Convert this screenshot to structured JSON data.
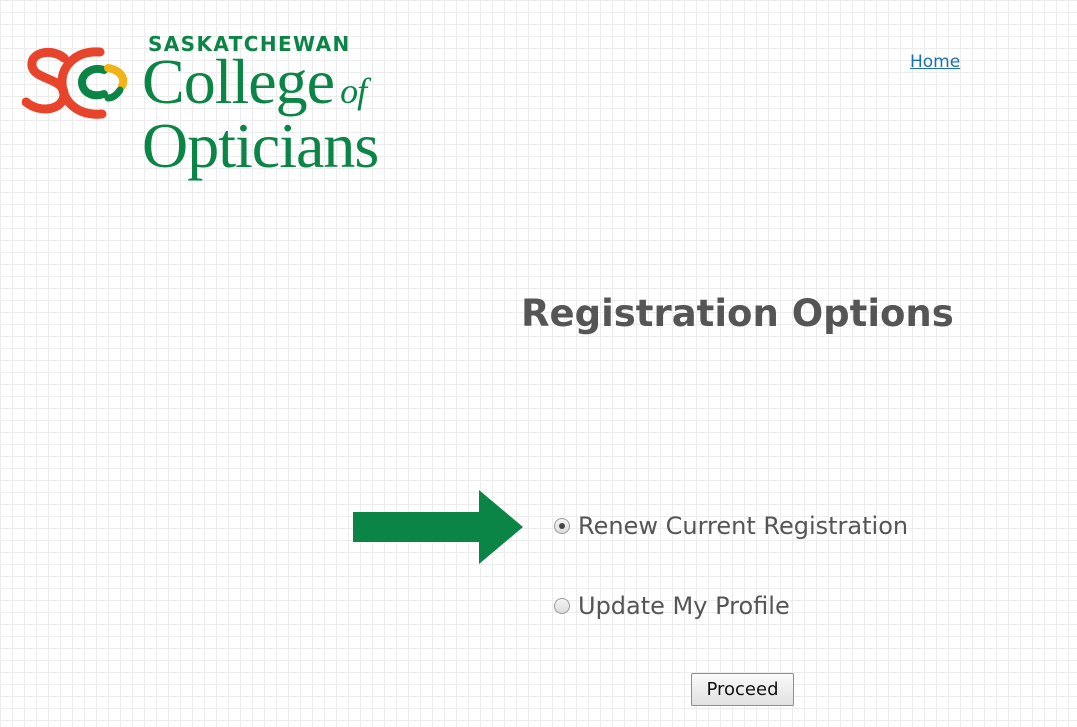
{
  "header": {
    "logo": {
      "small_text": "SASKATCHEWAN",
      "line1": "College",
      "line1_suffix": "of",
      "line2": "Opticians"
    },
    "nav": {
      "home_label": "Home"
    }
  },
  "main": {
    "title": "Registration Options",
    "options": [
      {
        "label": "Renew Current Registration",
        "selected": true
      },
      {
        "label": "Update My Profile",
        "selected": false
      }
    ],
    "proceed_label": "Proceed"
  },
  "colors": {
    "brand_green": "#0a8546",
    "logo_red": "#e8432b",
    "logo_yellow": "#f2b315",
    "heading_gray": "#555555",
    "link_blue": "#1a6fb5"
  },
  "icons": {
    "logo_mark": "sco-logo-mark",
    "annotation": "arrow-right-icon"
  }
}
